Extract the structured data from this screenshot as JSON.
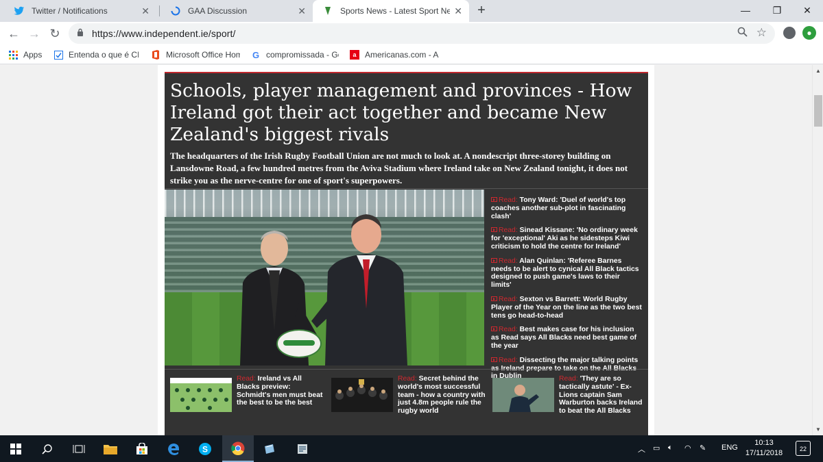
{
  "browser": {
    "tabs": [
      {
        "title": "Twitter / Notifications",
        "icon": "twitter-bird-icon",
        "close": "✕"
      },
      {
        "title": "GAA Discussion",
        "icon": "loading-spinner-icon",
        "close": "✕"
      },
      {
        "title": "Sports News - Latest Sport News",
        "icon": "independent-harp-icon",
        "close": "✕",
        "active": true
      }
    ],
    "new_tab": "+",
    "window_controls": {
      "minimize": "—",
      "maximize": "❐",
      "close": "✕"
    },
    "url": "https://www.independent.ie/sport/",
    "bookmarks": [
      {
        "label": "Apps",
        "icon": "apps-grid-icon"
      },
      {
        "label": "Entenda o que é CDI",
        "icon": "checkbox-icon"
      },
      {
        "label": "Microsoft Office Hom",
        "icon": "office-icon"
      },
      {
        "label": "compromissada - Go",
        "icon": "google-icon"
      },
      {
        "label": "Americanas.com - A l",
        "icon": "americanas-icon"
      }
    ]
  },
  "article": {
    "headline": "Schools, player management and provinces - How Ireland got their act together and became New Zealand's biggest rivals",
    "standfirst": "The headquarters of the Irish Rugby Football Union are not much to look at. A nondescript three-storey building on Lansdowne Road, a few hundred metres from the Aviva Stadium where Ireland take on New Zealand tonight, it does not strike you as the nerve-centre for one of sport's superpowers.",
    "read_label": "Read:",
    "side_links": [
      "Tony Ward: 'Duel of world's top coaches another sub-plot in fascinating clash'",
      "Sinead Kissane: 'No ordinary week for 'exceptional' Aki as he sidesteps Kiwi criticism to hold the centre for Ireland'",
      "Alan Quinlan: 'Referee Barnes needs to be alert to cynical All Black tactics designed to push game's laws to their limits'",
      "Sexton vs Barrett: World Rugby Player of the Year on the line as the two best tens go head-to-head",
      "Best makes case for his inclusion as Read says All Blacks need best game of the year",
      "Dissecting the major talking points as Ireland prepare to take on the All Blacks in Dublin"
    ],
    "bottom_links": [
      "Ireland vs All Blacks preview: Schmidt's men must beat the best to be the best",
      "Secret behind the world's most successful team - how a country with just 4.8m people rule the rugby world",
      "'They are so tactically astute' - Ex-Lions captain Sam Warburton backs Ireland to beat the All Blacks"
    ]
  },
  "taskbar": {
    "apps": [
      "windows-start-icon",
      "search-icon",
      "task-view-icon",
      "file-explorer-icon",
      "store-icon",
      "edge-icon",
      "skype-icon",
      "chrome-icon",
      "notepad-icon",
      "app-icon"
    ],
    "language": "ENG",
    "time": "10:13",
    "date": "17/11/2018",
    "notifications": "22"
  },
  "colors": {
    "accent": "#c0272d",
    "article_bg": "#333333",
    "read_red": "#d0282f"
  }
}
